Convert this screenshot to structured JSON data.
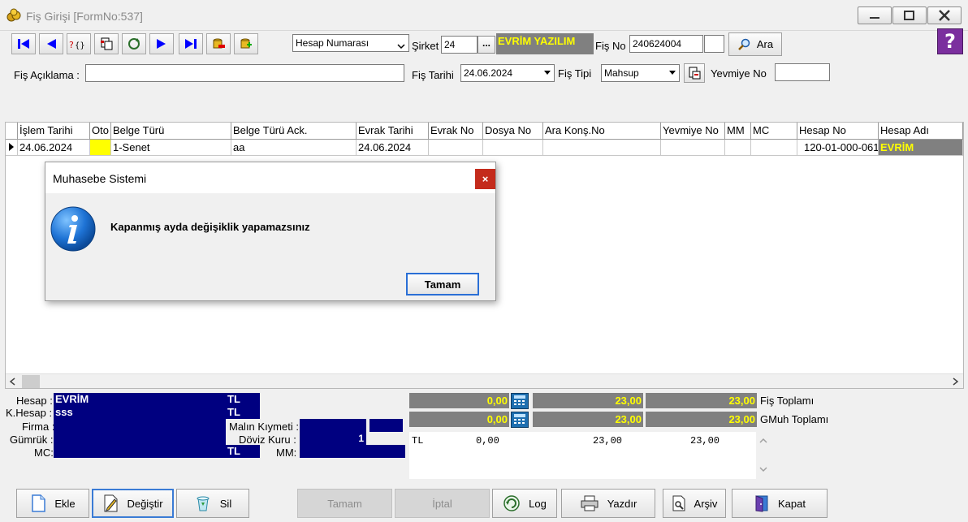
{
  "window": {
    "title": "Fiş Girişi [FormNo:537]"
  },
  "toolbar": {
    "search_mode": "Hesap Numarası",
    "company_label": "Şirket",
    "company_code": "24",
    "company_button": "...",
    "company_name": "EVRİM YAZILIM",
    "voucher_no_label": "Fiş No",
    "voucher_no": "240624004",
    "search_button": "Ara",
    "search_button_hotkey": "A",
    "help_glyph": "?"
  },
  "form": {
    "description_label": "Fiş Açıklama :",
    "description_value": "",
    "date_label": "Fiş Tarihi",
    "date_value": "24.06.2024",
    "type_label": "Fiş  Tipi",
    "type_value": "Mahsup",
    "journal_label": "Yevmiye No",
    "journal_value": ""
  },
  "grid": {
    "columns": [
      "İşlem Tarihi",
      "Oto",
      "Belge Türü",
      "Belge Türü Ack.",
      "Evrak Tarihi",
      "Evrak No",
      "Dosya No",
      "Ara Konş.No",
      "Yevmiye No",
      "MM",
      "MC",
      "Hesap No",
      "Hesap Adı"
    ],
    "rows": [
      [
        "24.06.2024",
        "",
        "1-Senet",
        "aa",
        "24.06.2024",
        "",
        "",
        "",
        "",
        "",
        "",
        "120-01-000-061",
        "EVRİM"
      ]
    ]
  },
  "details": {
    "account_label": "Hesap :",
    "account_value": "EVRİM",
    "account_currency": "TL",
    "counter_account_label": "K.Hesap :",
    "counter_account_value": "sss",
    "counter_currency": "TL",
    "company_label": "Firma :",
    "customs_label": "Gümrük :",
    "mc_label": "MC:",
    "mc_currency": "TL",
    "goods_value_label": "Malın Kıymeti :",
    "exchange_rate_label": "Döviz Kuru :",
    "exchange_rate_value": "1",
    "mm_label": "MM:"
  },
  "totals": {
    "row1": [
      "0,00",
      "23,00",
      "23,00"
    ],
    "row1_label": "Fiş Toplamı",
    "row2": [
      "0,00",
      "23,00",
      "23,00"
    ],
    "row2_label": "GMuh Toplamı",
    "summary_currency": "TL",
    "summary_values": [
      "0,00",
      "23,00",
      "23,00"
    ]
  },
  "buttons": {
    "add": "Ekle",
    "edit": "Değiştir",
    "delete": "Sil",
    "ok": "Tamam",
    "cancel": "İptal",
    "log": "Log",
    "print": "Yazdır",
    "archive": "Arşiv",
    "close": "Kapat"
  },
  "dialog": {
    "title": "Muhasebe Sistemi",
    "message": "Kapanmış ayda değişiklik yapamazsınız",
    "ok_button": "Tamam",
    "close_glyph": "×"
  },
  "colors": {
    "navy": "#000080",
    "yellow": "#ffff00",
    "gray": "#808080",
    "close_red": "#c42b1c"
  }
}
